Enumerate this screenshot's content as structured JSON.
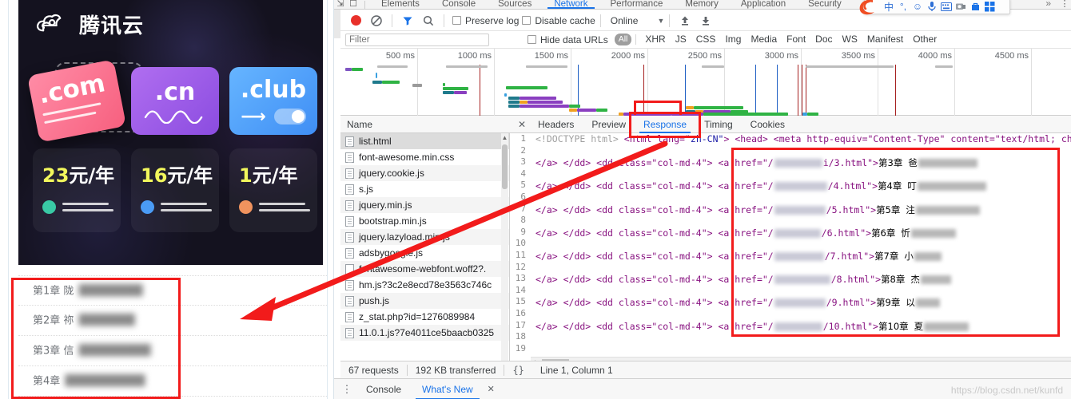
{
  "left_page": {
    "ad": {
      "brand": "腾讯云",
      "brand_logo_icon": "tencent-cloud-logo-icon",
      "tld_cards": [
        {
          "label": ".com",
          "icon": "com-card-icon"
        },
        {
          "label": ".cn",
          "icon": "cn-card-icon"
        },
        {
          "label": ".club",
          "icon": "club-card-icon"
        }
      ],
      "prices": [
        {
          "num": "23",
          "unit": "元/年",
          "dot_color": "#39c9a5"
        },
        {
          "num": "16",
          "unit": "元/年",
          "dot_color": "#4a9bf5"
        },
        {
          "num": "1",
          "unit": "元/年",
          "dot_color": "#f0935e"
        }
      ],
      "bg_color": "#14121f",
      "price_color": "#f2f75c"
    },
    "chapters": [
      {
        "prefix": "第1章",
        "visible": "陇",
        "blurred": "████████"
      },
      {
        "prefix": "第2章",
        "visible": "祢",
        "blurred": "███████"
      },
      {
        "prefix": "第3章",
        "visible": "信",
        "blurred": "█████████"
      },
      {
        "prefix": "第4章",
        "visible": "",
        "blurred": "██████████"
      }
    ]
  },
  "devtools": {
    "panel_tabs": [
      {
        "label": "Elements",
        "active": false
      },
      {
        "label": "Console",
        "active": false
      },
      {
        "label": "Sources",
        "active": false
      },
      {
        "label": "Network",
        "active": true
      },
      {
        "label": "Performance",
        "active": false
      },
      {
        "label": "Memory",
        "active": false
      },
      {
        "label": "Application",
        "active": false
      },
      {
        "label": "Security",
        "active": false
      }
    ],
    "tabs_more": "»",
    "toolbar": {
      "record_icon": "record-button-icon",
      "clear_icon": "clear-icon",
      "filter_icon": "filter-funnel-icon",
      "search_icon": "search-icon",
      "preserve_log": "Preserve log",
      "disable_cache": "Disable cache",
      "throttling": "Online",
      "import_icon": "import-har-icon",
      "export_icon": "export-har-icon"
    },
    "filter_bar": {
      "placeholder": "Filter",
      "value": "",
      "hide_data_urls": "Hide data URLs",
      "types": [
        "All",
        "XHR",
        "JS",
        "CSS",
        "Img",
        "Media",
        "Font",
        "Doc",
        "WS",
        "Manifest",
        "Other"
      ],
      "active_type": "All"
    },
    "overview": {
      "ticks": [
        "500 ms",
        "1000 ms",
        "1500 ms",
        "2000 ms",
        "2500 ms",
        "3000 ms",
        "3500 ms",
        "4000 ms",
        "4500 ms"
      ]
    },
    "request_table": {
      "header": "Name",
      "rows": [
        "list.html",
        "font-awesome.min.css",
        "jquery.cookie.js",
        "s.js",
        "jquery.min.js",
        "bootstrap.min.js",
        "jquery.lazyload.min.js",
        "adsbygoogle.js",
        "fontawesome-webfont.woff2?.",
        "hm.js?3c2e8ecd78e3563c746c",
        "push.js",
        "z_stat.php?id=1276089984",
        "11.0.1.js?7e4011ce5baacb0325"
      ],
      "selected_row": "list.html"
    },
    "detail": {
      "close_icon": "close-icon",
      "tabs": [
        "Headers",
        "Preview",
        "Response",
        "Timing",
        "Cookies"
      ],
      "active_tab": "Response",
      "code": {
        "line1": {
          "num": "1",
          "doctype": "<!DOCTYPE html>",
          "html_tag": "<html lang=",
          "lang_val": "\"zh-CN\"",
          "html_tag_close": ">",
          "head": "<head>",
          "meta": "<meta http-equiv=\"Content-Type\" content=\"text/html; cha"
        },
        "left_repeat": "</a>   </dd>    <dd class=\"col-md-4\">",
        "chapter_links": [
          {
            "line": "3",
            "href_tail": "i/3.html\">",
            "chapter": "第3章",
            "vis": "爸"
          },
          {
            "line": "5",
            "href_tail": "/4.html\">",
            "chapter": "第4章",
            "vis": "叮"
          },
          {
            "line": "7",
            "href_tail": "/5.html\">",
            "chapter": "第5章",
            "vis": "注"
          },
          {
            "line": "9",
            "href_tail": "/6.html\">",
            "chapter": "第6章",
            "vis": "忻"
          },
          {
            "line": "11",
            "href_tail": "/7.html\">",
            "chapter": "第7章",
            "vis": "小"
          },
          {
            "line": "13",
            "href_tail": "/8.html\">",
            "chapter": "第8章",
            "vis": "杰"
          },
          {
            "line": "15",
            "href_tail": "/9.html\">",
            "chapter": "第9章",
            "vis": "以"
          },
          {
            "line": "17",
            "href_tail": "/10.html\">",
            "chapter": "第10章",
            "vis": "夏"
          }
        ],
        "blank_lines": [
          "2",
          "4",
          "6",
          "8",
          "10",
          "12",
          "14",
          "16",
          "18",
          "19"
        ]
      }
    },
    "status_bar": {
      "requests": "67 requests",
      "transferred": "192 KB transferred",
      "format_icon": "{}",
      "cursor": "Line 1, Column 1"
    },
    "drawer": {
      "kebab_icon": "more-options-icon",
      "tabs": [
        "Console",
        "What's New"
      ],
      "active_tab": "What's New",
      "close_icon": "close-icon"
    }
  },
  "ime_toolbar": {
    "logo_icon": "sogou-logo-icon",
    "icons": [
      "chinese-mode-icon",
      "punctuation-icon",
      "emoji-icon",
      "voice-input-icon",
      "soft-keyboard-icon",
      "screenshot-icon",
      "toolbox-icon",
      "apps-grid-icon"
    ]
  },
  "annotations": {
    "watermark": "https://blog.csdn.net/kunfd",
    "accent_color": "#f21b1b"
  }
}
